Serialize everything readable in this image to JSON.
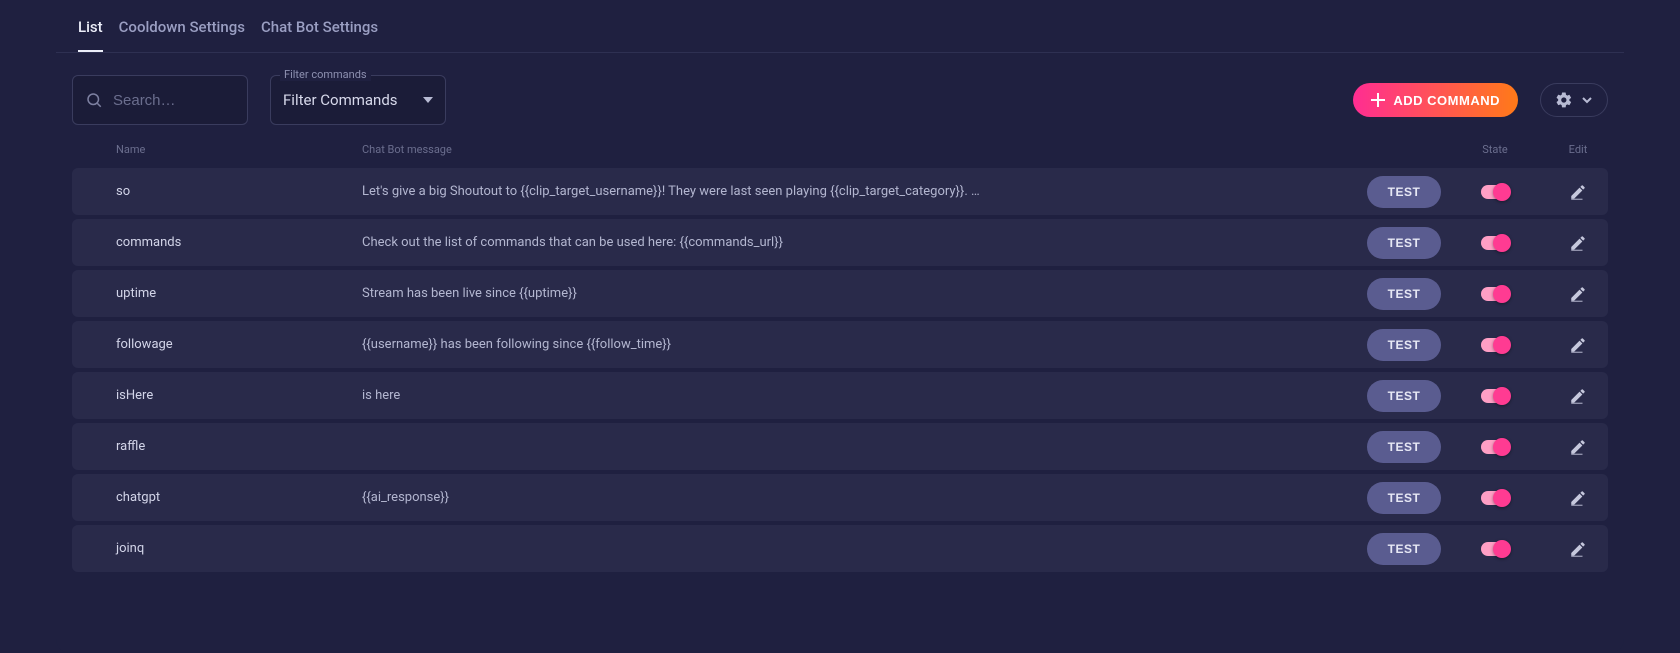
{
  "tabs": {
    "list": "List",
    "cooldown": "Cooldown Settings",
    "chatbot": "Chat Bot Settings"
  },
  "toolbar": {
    "search_placeholder": "Search…",
    "filter_label": "Filter commands",
    "filter_value": "Filter Commands",
    "add_label": "ADD COMMAND"
  },
  "headers": {
    "name": "Name",
    "msg": "Chat Bot message",
    "state": "State",
    "edit": "Edit"
  },
  "test_label": "TEST",
  "rows": [
    {
      "name": "so",
      "msg": "Let's give a big Shoutout to {{clip_target_username}}! They were last seen playing {{clip_target_category}}. …"
    },
    {
      "name": "commands",
      "msg": "Check out the list of commands that can be used here: {{commands_url}}"
    },
    {
      "name": "uptime",
      "msg": "Stream has been live since {{uptime}}"
    },
    {
      "name": "followage",
      "msg": "{{username}} has been following since {{follow_time}}"
    },
    {
      "name": "isHere",
      "msg": "is here"
    },
    {
      "name": "raffle",
      "msg": ""
    },
    {
      "name": "chatgpt",
      "msg": "{{ai_response}}"
    },
    {
      "name": "joinq",
      "msg": ""
    }
  ]
}
